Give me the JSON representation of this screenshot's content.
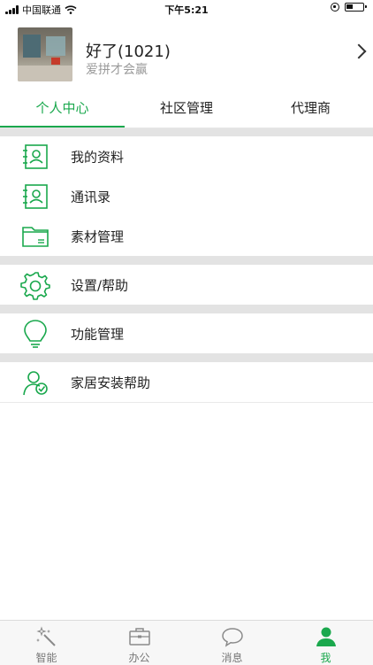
{
  "status_bar": {
    "carrier": "中国联通",
    "time": "下午5:21"
  },
  "profile": {
    "name": "好了(1021)",
    "subtitle": "爱拼才会赢"
  },
  "tabs": [
    {
      "label": "个人中心",
      "active": true
    },
    {
      "label": "社区管理",
      "active": false
    },
    {
      "label": "代理商",
      "active": false
    }
  ],
  "menu": [
    {
      "label": "我的资料",
      "icon": "profile-card-icon"
    },
    {
      "label": "通讯录",
      "icon": "contacts-icon"
    },
    {
      "label": "素材管理",
      "icon": "folder-icon"
    },
    {
      "label": "设置/帮助",
      "icon": "gear-icon"
    },
    {
      "label": "功能管理",
      "icon": "lightbulb-icon"
    },
    {
      "label": "家居安装帮助",
      "icon": "install-help-icon"
    }
  ],
  "bottom_nav": [
    {
      "label": "智能",
      "icon": "magic-wand-icon",
      "active": false
    },
    {
      "label": "办公",
      "icon": "briefcase-icon",
      "active": false
    },
    {
      "label": "消息",
      "icon": "chat-bubble-icon",
      "active": false
    },
    {
      "label": "我",
      "icon": "person-icon",
      "active": true
    }
  ],
  "colors": {
    "accent": "#1aa84d",
    "separator": "#e3e3e3"
  }
}
